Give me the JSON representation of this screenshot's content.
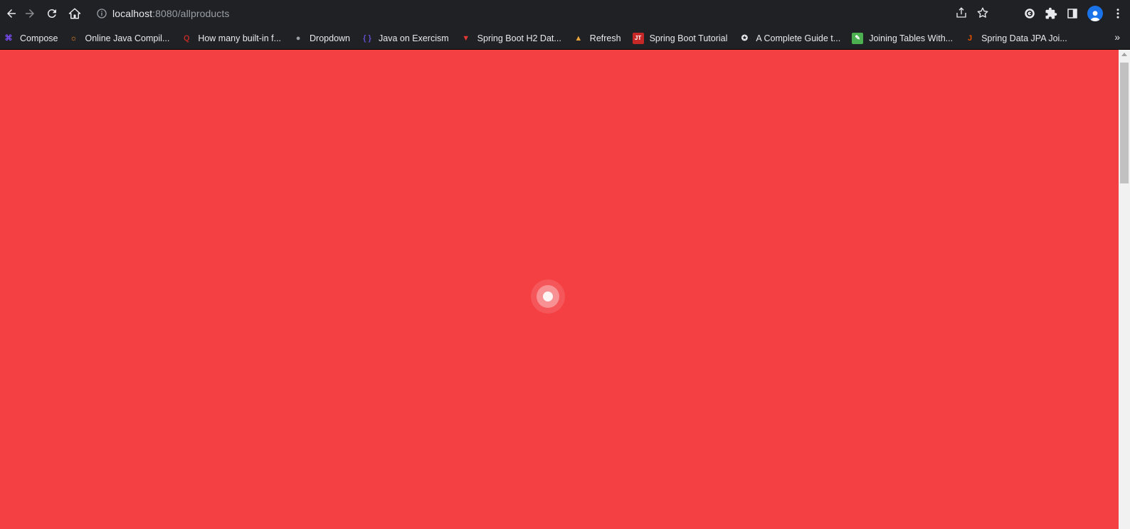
{
  "browser": {
    "url_host": "localhost",
    "url_rest": ":8080/allproducts"
  },
  "bookmarks": [
    {
      "label": "Compose",
      "icon": "compose-icon",
      "color": "#7c4dff"
    },
    {
      "label": "Online Java Compil...",
      "icon": "online-compiler-icon",
      "color": "#f28c28"
    },
    {
      "label": "How many built-in f...",
      "icon": "quora-icon",
      "color": "#b92b27"
    },
    {
      "label": "Dropdown",
      "icon": "globe-icon",
      "color": "#9aa0a6"
    },
    {
      "label": "Java on Exercism",
      "icon": "exercism-icon",
      "color": "#604fcd"
    },
    {
      "label": "Spring Boot H2 Dat...",
      "icon": "triangle-logo-icon",
      "color": "#e53935"
    },
    {
      "label": "Refresh",
      "icon": "refresh-logo-icon",
      "color": "#e8a33d"
    },
    {
      "label": "Spring Boot Tutorial",
      "icon": "javatpoint-icon",
      "color": "#c62828"
    },
    {
      "label": "A Complete Guide t...",
      "icon": "star-badge-icon",
      "color": "#e8eaed"
    },
    {
      "label": "Joining Tables With...",
      "icon": "leaf-icon",
      "color": "#4caf50"
    },
    {
      "label": "Spring Data JPA Joi...",
      "icon": "j-logo-icon",
      "color": "#e65100"
    }
  ],
  "bookmarks_more": "»",
  "colors": {
    "page_background": "#f43f43",
    "chrome_background": "#202124"
  },
  "loader": {
    "icon": "loading-spinner-icon"
  }
}
